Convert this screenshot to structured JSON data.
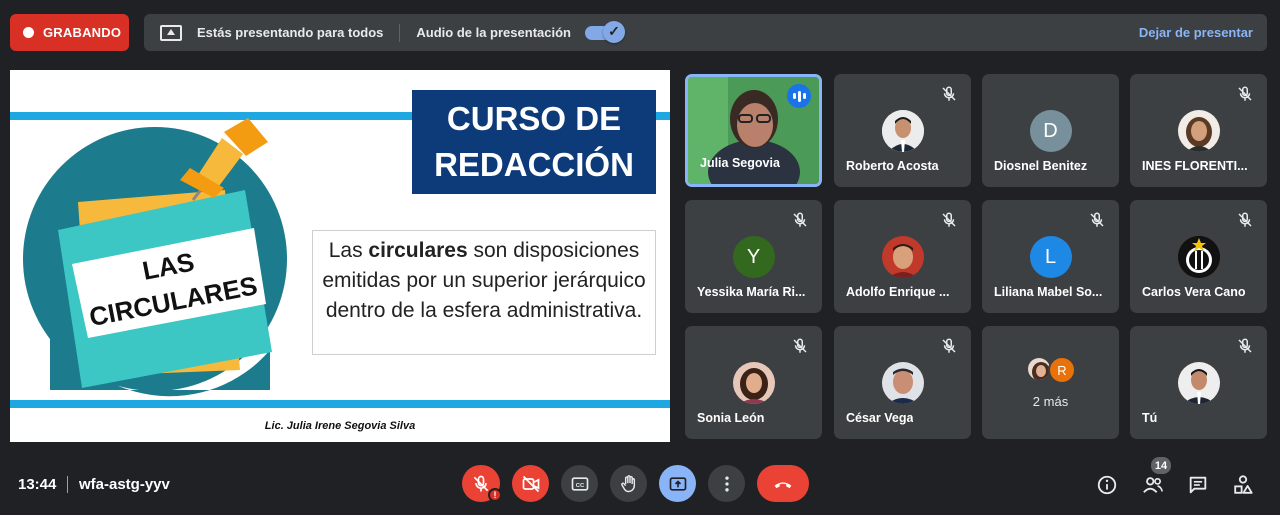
{
  "recording": {
    "label": "GRABANDO"
  },
  "presentation_bar": {
    "presenting_text": "Estás presentando para todos",
    "audio_text": "Audio de la presentación",
    "audio_enabled": true,
    "stop_label": "Dejar de presentar"
  },
  "slide": {
    "title_line1": "CURSO DE",
    "title_line2": "REDACCIÓN",
    "badge_line1": "LAS",
    "badge_line2": "CIRCULARES",
    "description_pre": "Las ",
    "description_bold": "circulares",
    "description_post": " son disposiciones emitidas por un superior jerárquico dentro de la esfera administrativa.",
    "author": "Lic. Julia Irene Segovia Silva"
  },
  "participants": [
    {
      "name": "Julia Segovia",
      "speaking": true
    },
    {
      "name": "Roberto Acosta",
      "muted": true
    },
    {
      "name": "Diosnel Benitez",
      "initial": "D",
      "avatar_color": "#78909c"
    },
    {
      "name": "INES FLORENTI...",
      "muted": true
    },
    {
      "name": "Yessika María Ri...",
      "initial": "Y",
      "avatar_color": "#33691e",
      "muted": true
    },
    {
      "name": "Adolfo Enrique ...",
      "muted": true
    },
    {
      "name": "Liliana Mabel So...",
      "initial": "L",
      "avatar_color": "#1e88e5",
      "muted": true
    },
    {
      "name": "Carlos Vera Cano",
      "muted": true
    },
    {
      "name": "Sonia León",
      "muted": true
    },
    {
      "name": "César Vega",
      "muted": true
    },
    {
      "name": "2 más",
      "overflow_initial": "R",
      "overflow_color": "#e8710a"
    },
    {
      "name": "Tú",
      "muted": true
    }
  ],
  "bottom": {
    "time": "13:44",
    "meeting_code": "wfa-astg-yyv",
    "participant_count": "14"
  },
  "icons": {
    "mic": "mic-off-icon",
    "camera": "camera-off-icon",
    "captions": "captions-icon",
    "hand": "raise-hand-icon",
    "present": "present-screen-icon",
    "more": "more-options-icon",
    "end": "end-call-icon",
    "info": "info-icon",
    "people": "people-icon",
    "chat": "chat-icon",
    "activities": "activities-icon"
  },
  "colors": {
    "recording": "#d93025",
    "accent": "#8ab4f8",
    "end_call": "#ea4335",
    "background": "#202124",
    "tile": "#3c4043"
  }
}
